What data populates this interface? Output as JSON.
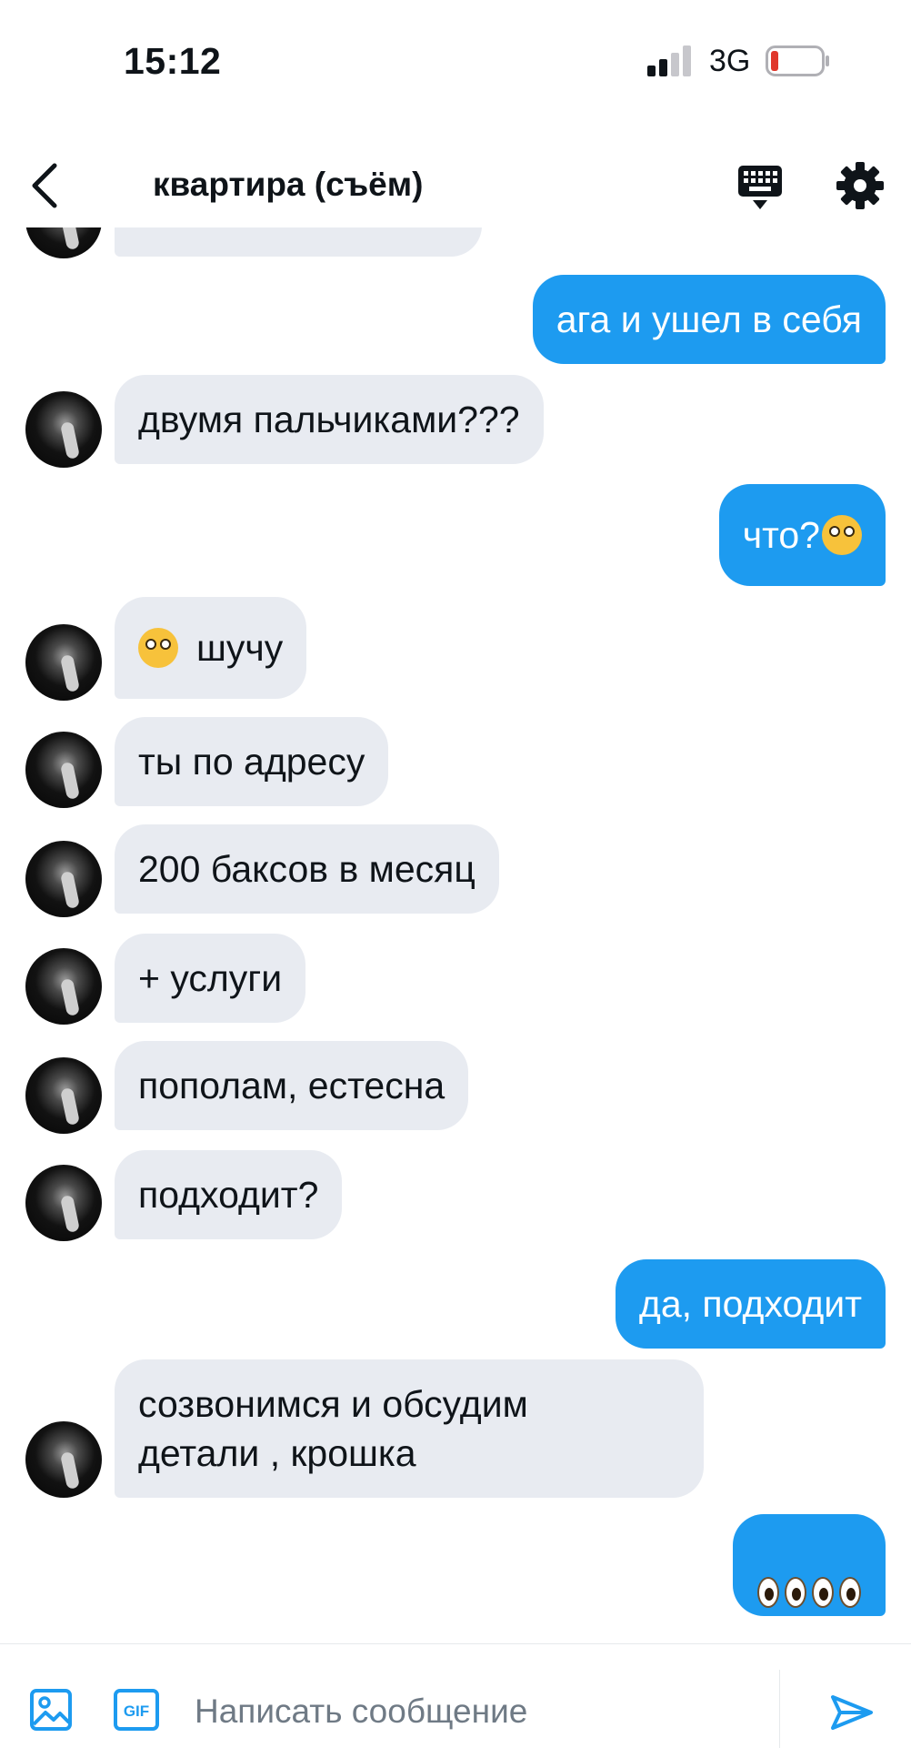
{
  "status_bar": {
    "time": "15:12",
    "network": "3G"
  },
  "header": {
    "title": "квартира (съём)"
  },
  "messages": [
    {
      "text": "ага и ушел в себя"
    },
    {
      "text": "двумя пальчиками???"
    },
    {
      "text": "что?"
    },
    {
      "text": "шучу"
    },
    {
      "text": "ты по адресу"
    },
    {
      "text": "200 баксов в месяц"
    },
    {
      "text": "+ услуги"
    },
    {
      "text": "пополам, естесна"
    },
    {
      "text": "подходит?"
    },
    {
      "text": "да, подходит"
    },
    {
      "text": "созвонимся и обсудим\nдетали , крошка"
    }
  ],
  "composer": {
    "placeholder": "Написать сообщение",
    "gif_label": "GIF"
  },
  "colors": {
    "accent": "#1d9bf0",
    "incoming_bubble": "#e8ebf1",
    "battery_low": "#e0372b"
  },
  "icons": [
    "back-chevron-icon",
    "keyboard-icon",
    "gear-icon",
    "image-icon",
    "gif-icon",
    "send-icon"
  ]
}
